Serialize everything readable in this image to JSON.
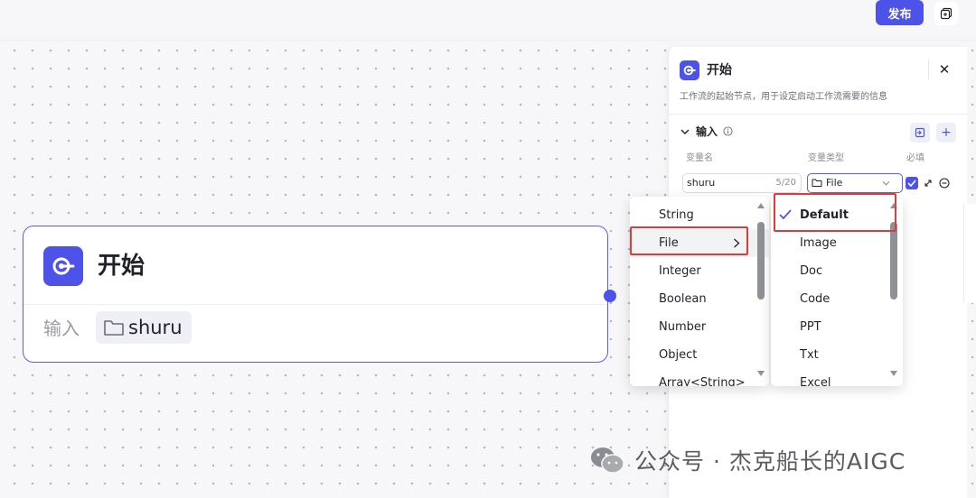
{
  "header": {
    "publish_label": "发布",
    "copy_icon": "copy-window-icon"
  },
  "node": {
    "title": "开始",
    "input_label": "输入",
    "chip_value": "shuru",
    "icon": "start-node-icon",
    "chip_icon": "folder-icon",
    "accent": "#4d53e8"
  },
  "panel": {
    "title": "开始",
    "description": "工作流的起始节点，用于设定启动工作流需要的信息",
    "close_label": "✕",
    "section_title": "输入",
    "add_label": "+",
    "columns": [
      "变量名",
      "变量类型",
      "必填"
    ],
    "row": {
      "name_value": "shuru",
      "name_count": "5/20",
      "type_value": "File",
      "required": true
    }
  },
  "type_menu": {
    "items": [
      {
        "label": "String",
        "active": false
      },
      {
        "label": "File",
        "active": true,
        "has_submenu": true
      },
      {
        "label": "Integer",
        "active": false
      },
      {
        "label": "Boolean",
        "active": false
      },
      {
        "label": "Number",
        "active": false
      },
      {
        "label": "Object",
        "active": false
      },
      {
        "label": "Array<String>",
        "active": false
      }
    ]
  },
  "file_submenu": {
    "items": [
      {
        "label": "Default",
        "selected": true
      },
      {
        "label": "Image",
        "selected": false
      },
      {
        "label": "Doc",
        "selected": false
      },
      {
        "label": "Code",
        "selected": false
      },
      {
        "label": "PPT",
        "selected": false
      },
      {
        "label": "Txt",
        "selected": false
      },
      {
        "label": "Excel",
        "selected": false
      }
    ]
  },
  "watermark": {
    "text": "公众号 · 杰克船长的AIGC",
    "icon": "wechat-icon"
  },
  "colors": {
    "accent": "#4d53e8",
    "highlight": "#e03a3a"
  }
}
